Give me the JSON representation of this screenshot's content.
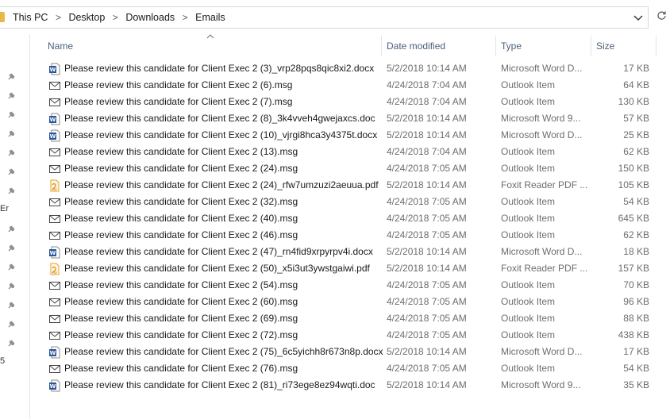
{
  "address": {
    "crumbs": [
      "This PC",
      "Desktop",
      "Downloads",
      "Emails"
    ],
    "separator": ">",
    "dropdown_icon": "chevron-down-icon",
    "refresh_icon": "refresh-icon"
  },
  "nav_fragments": [
    "Er",
    "5"
  ],
  "columns": {
    "name": "Name",
    "date": "Date modified",
    "type": "Type",
    "size": "Size"
  },
  "colors": {
    "header_text": "#4c607a",
    "meta_text": "#6d6d6d",
    "word_blue": "#2b579a",
    "pdf_orange": "#e8a020"
  },
  "files": [
    {
      "icon": "word-icon",
      "name": "Please review this candidate for Client Exec 2 (3)_vrp28pqs8qic8xi2.docx",
      "date": "5/2/2018 10:14 AM",
      "type": "Microsoft Word D...",
      "size": "17 KB"
    },
    {
      "icon": "mail-icon",
      "name": "Please review this candidate for Client Exec 2 (6).msg",
      "date": "4/24/2018 7:04 AM",
      "type": "Outlook Item",
      "size": "64 KB"
    },
    {
      "icon": "mail-icon",
      "name": "Please review this candidate for Client Exec 2 (7).msg",
      "date": "4/24/2018 7:04 AM",
      "type": "Outlook Item",
      "size": "130 KB"
    },
    {
      "icon": "word-icon",
      "name": "Please review this candidate for Client Exec 2 (8)_3k4vveh4gwejaxcs.doc",
      "date": "5/2/2018 10:14 AM",
      "type": "Microsoft Word 9...",
      "size": "57 KB"
    },
    {
      "icon": "word-icon",
      "name": "Please review this candidate for Client Exec 2 (10)_vjrgi8hca3y4375t.docx",
      "date": "5/2/2018 10:14 AM",
      "type": "Microsoft Word D...",
      "size": "25 KB"
    },
    {
      "icon": "mail-icon",
      "name": "Please review this candidate for Client Exec 2 (13).msg",
      "date": "4/24/2018 7:04 AM",
      "type": "Outlook Item",
      "size": "62 KB"
    },
    {
      "icon": "mail-icon",
      "name": "Please review this candidate for Client Exec 2 (24).msg",
      "date": "4/24/2018 7:05 AM",
      "type": "Outlook Item",
      "size": "150 KB"
    },
    {
      "icon": "pdf-icon",
      "name": "Please review this candidate for Client Exec 2 (24)_rfw7umzuzi2aeuua.pdf",
      "date": "5/2/2018 10:14 AM",
      "type": "Foxit Reader PDF ...",
      "size": "105 KB"
    },
    {
      "icon": "mail-icon",
      "name": "Please review this candidate for Client Exec 2 (32).msg",
      "date": "4/24/2018 7:05 AM",
      "type": "Outlook Item",
      "size": "54 KB"
    },
    {
      "icon": "mail-icon",
      "name": "Please review this candidate for Client Exec 2 (40).msg",
      "date": "4/24/2018 7:05 AM",
      "type": "Outlook Item",
      "size": "645 KB"
    },
    {
      "icon": "mail-icon",
      "name": "Please review this candidate for Client Exec 2 (46).msg",
      "date": "4/24/2018 7:05 AM",
      "type": "Outlook Item",
      "size": "62 KB"
    },
    {
      "icon": "word-icon",
      "name": "Please review this candidate for Client Exec 2 (47)_rn4fid9xrpyrpv4i.docx",
      "date": "5/2/2018 10:14 AM",
      "type": "Microsoft Word D...",
      "size": "18 KB"
    },
    {
      "icon": "pdf-icon",
      "name": "Please review this candidate for Client Exec 2 (50)_x5i3ut3ywstgaiwi.pdf",
      "date": "5/2/2018 10:14 AM",
      "type": "Foxit Reader PDF ...",
      "size": "157 KB"
    },
    {
      "icon": "mail-icon",
      "name": "Please review this candidate for Client Exec 2 (54).msg",
      "date": "4/24/2018 7:05 AM",
      "type": "Outlook Item",
      "size": "70 KB"
    },
    {
      "icon": "mail-icon",
      "name": "Please review this candidate for Client Exec 2 (60).msg",
      "date": "4/24/2018 7:05 AM",
      "type": "Outlook Item",
      "size": "96 KB"
    },
    {
      "icon": "mail-icon",
      "name": "Please review this candidate for Client Exec 2 (69).msg",
      "date": "4/24/2018 7:05 AM",
      "type": "Outlook Item",
      "size": "88 KB"
    },
    {
      "icon": "mail-icon",
      "name": "Please review this candidate for Client Exec 2 (72).msg",
      "date": "4/24/2018 7:05 AM",
      "type": "Outlook Item",
      "size": "438 KB"
    },
    {
      "icon": "word-icon",
      "name": "Please review this candidate for Client Exec 2 (75)_6c5yichh8r673n8p.docx",
      "date": "5/2/2018 10:14 AM",
      "type": "Microsoft Word D...",
      "size": "17 KB"
    },
    {
      "icon": "mail-icon",
      "name": "Please review this candidate for Client Exec 2 (76).msg",
      "date": "4/24/2018 7:05 AM",
      "type": "Outlook Item",
      "size": "54 KB"
    },
    {
      "icon": "word-icon",
      "name": "Please review this candidate for Client Exec 2 (81)_ri73ege8ez94wqti.doc",
      "date": "5/2/2018 10:14 AM",
      "type": "Microsoft Word 9...",
      "size": "35 KB"
    }
  ]
}
